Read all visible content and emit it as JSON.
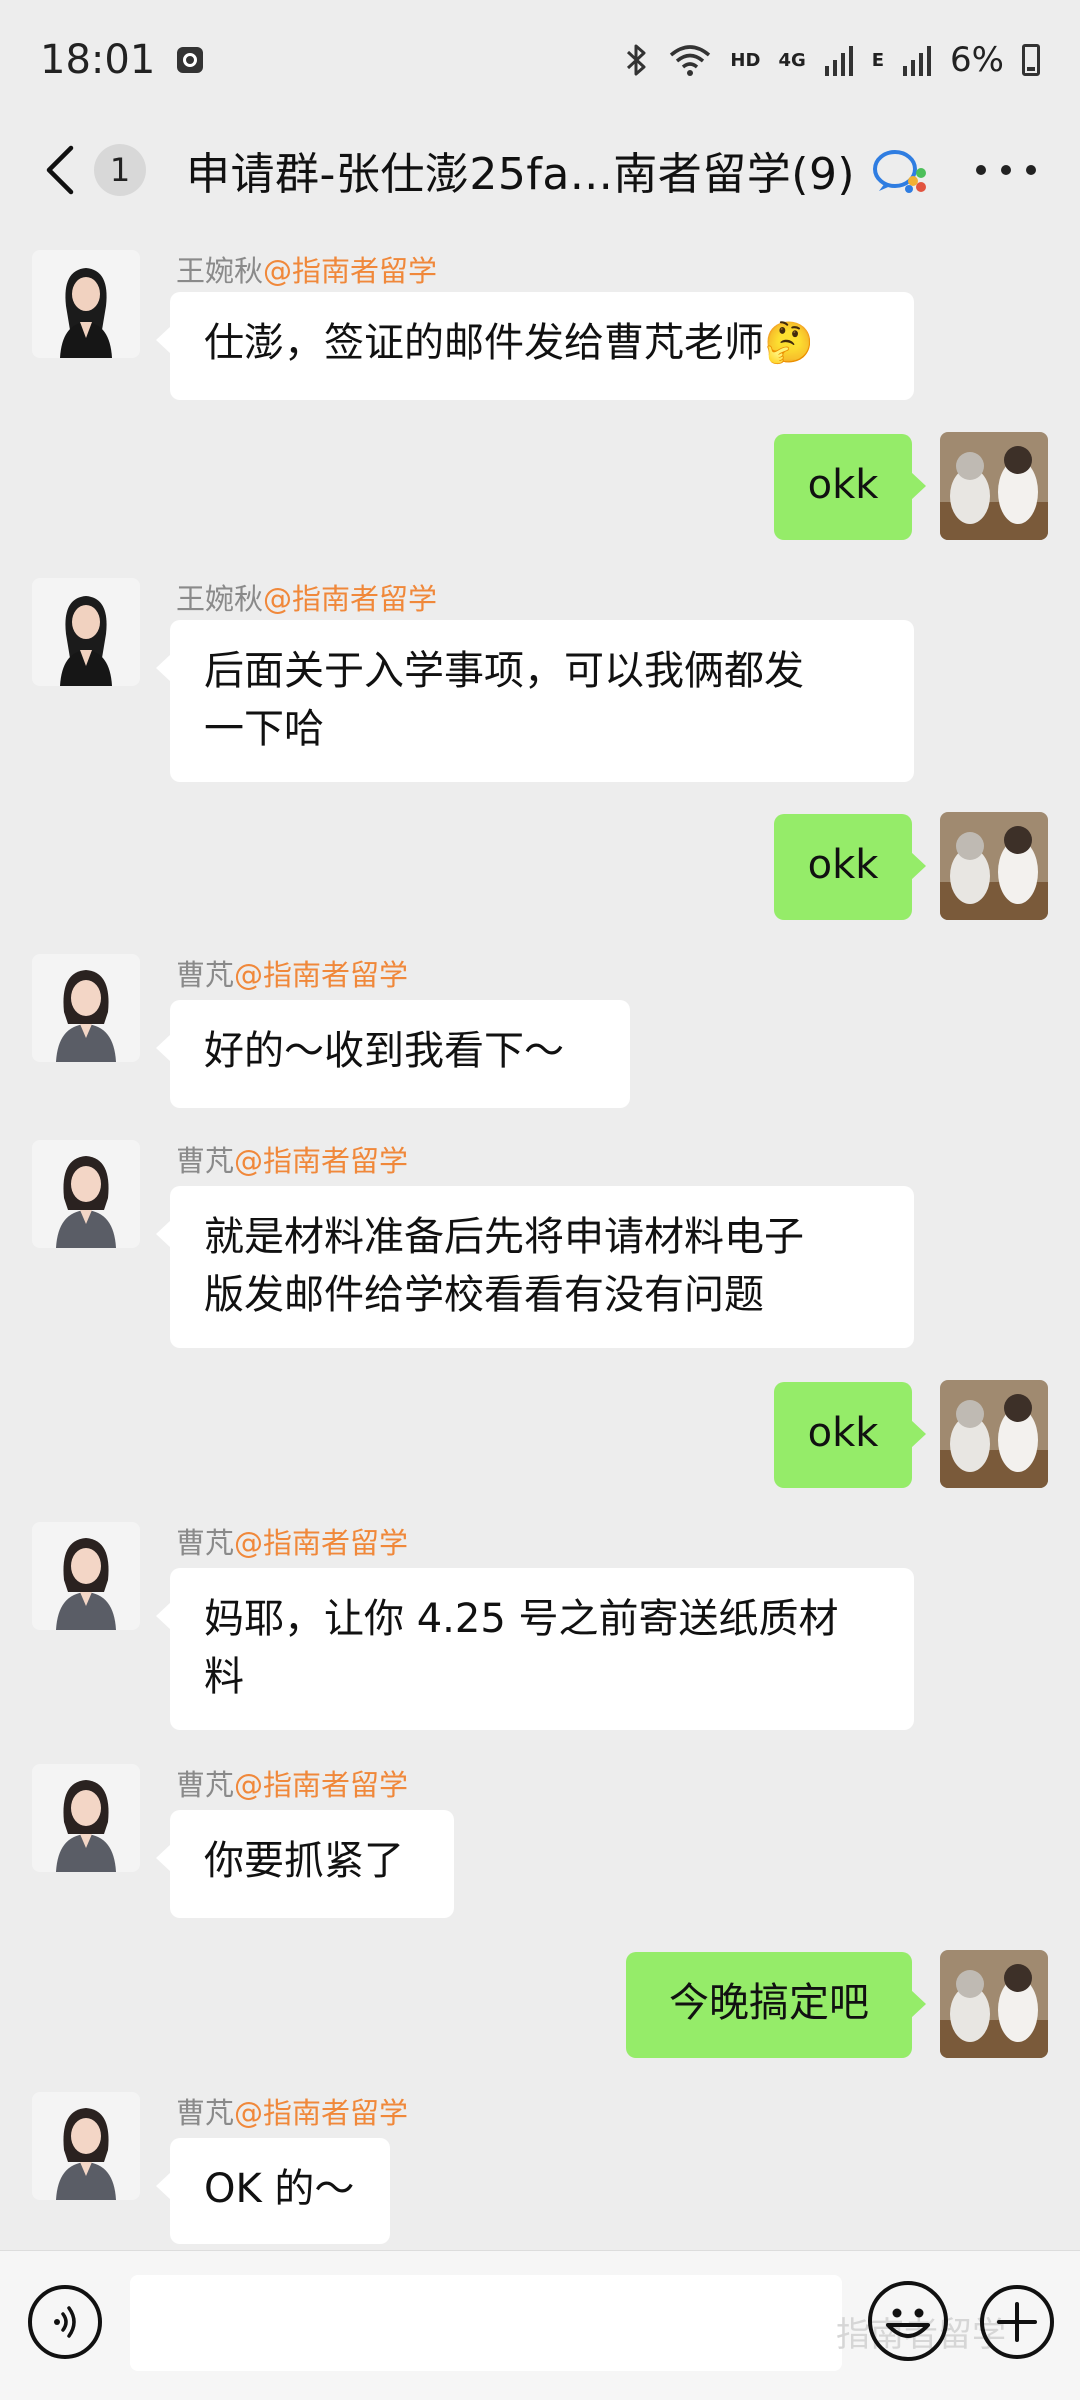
{
  "status_bar": {
    "time": "18:01",
    "network_hd": "HD",
    "network_4g": "4G",
    "network_e": "E",
    "battery": "6%"
  },
  "header": {
    "unread_count": "1",
    "title": "申请群-张仕澎25fa...南者留学(9)"
  },
  "messages": [
    {
      "side": "left",
      "sender_name": "王婉秋",
      "sender_org": "@指南者留学",
      "text": "仕澎，签证的邮件发给曹芃老师🤔"
    },
    {
      "side": "right",
      "text": "okk"
    },
    {
      "side": "left",
      "sender_name": "王婉秋",
      "sender_org": "@指南者留学",
      "line1": "后面关于入学事项，可以我俩都发",
      "line2": "一下哈"
    },
    {
      "side": "right",
      "text": "okk"
    },
    {
      "side": "left",
      "sender_name": "曹芃",
      "sender_org": "@指南者留学",
      "text": "好的～收到我看下～"
    },
    {
      "side": "left",
      "sender_name": "曹芃",
      "sender_org": "@指南者留学",
      "line1": "就是材料准备后先将申请材料电子",
      "line2": "版发邮件给学校看看有没有问题"
    },
    {
      "side": "right",
      "text": "okk"
    },
    {
      "side": "left",
      "sender_name": "曹芃",
      "sender_org": "@指南者留学",
      "line1": "妈耶，让你 4.25 号之前寄送纸质材",
      "line2": "料"
    },
    {
      "side": "left",
      "sender_name": "曹芃",
      "sender_org": "@指南者留学",
      "text": "你要抓紧了"
    },
    {
      "side": "right",
      "text": "今晚搞定吧"
    },
    {
      "side": "left",
      "sender_name": "曹芃",
      "sender_org": "@指南者留学",
      "text": "OK 的～"
    }
  ],
  "input_bar": {
    "text_value": "",
    "watermark": "指南者留学"
  },
  "colors": {
    "background": "#ededed",
    "bubble_self": "#95ec69",
    "bubble_other": "#ffffff",
    "org_tag": "#f0883a"
  },
  "icons": {
    "back": "chevron-left-icon",
    "wecom": "wecom-group-icon",
    "more": "more-dots-icon",
    "voice": "voice-icon",
    "emoji": "emoji-icon",
    "plus": "plus-icon"
  }
}
